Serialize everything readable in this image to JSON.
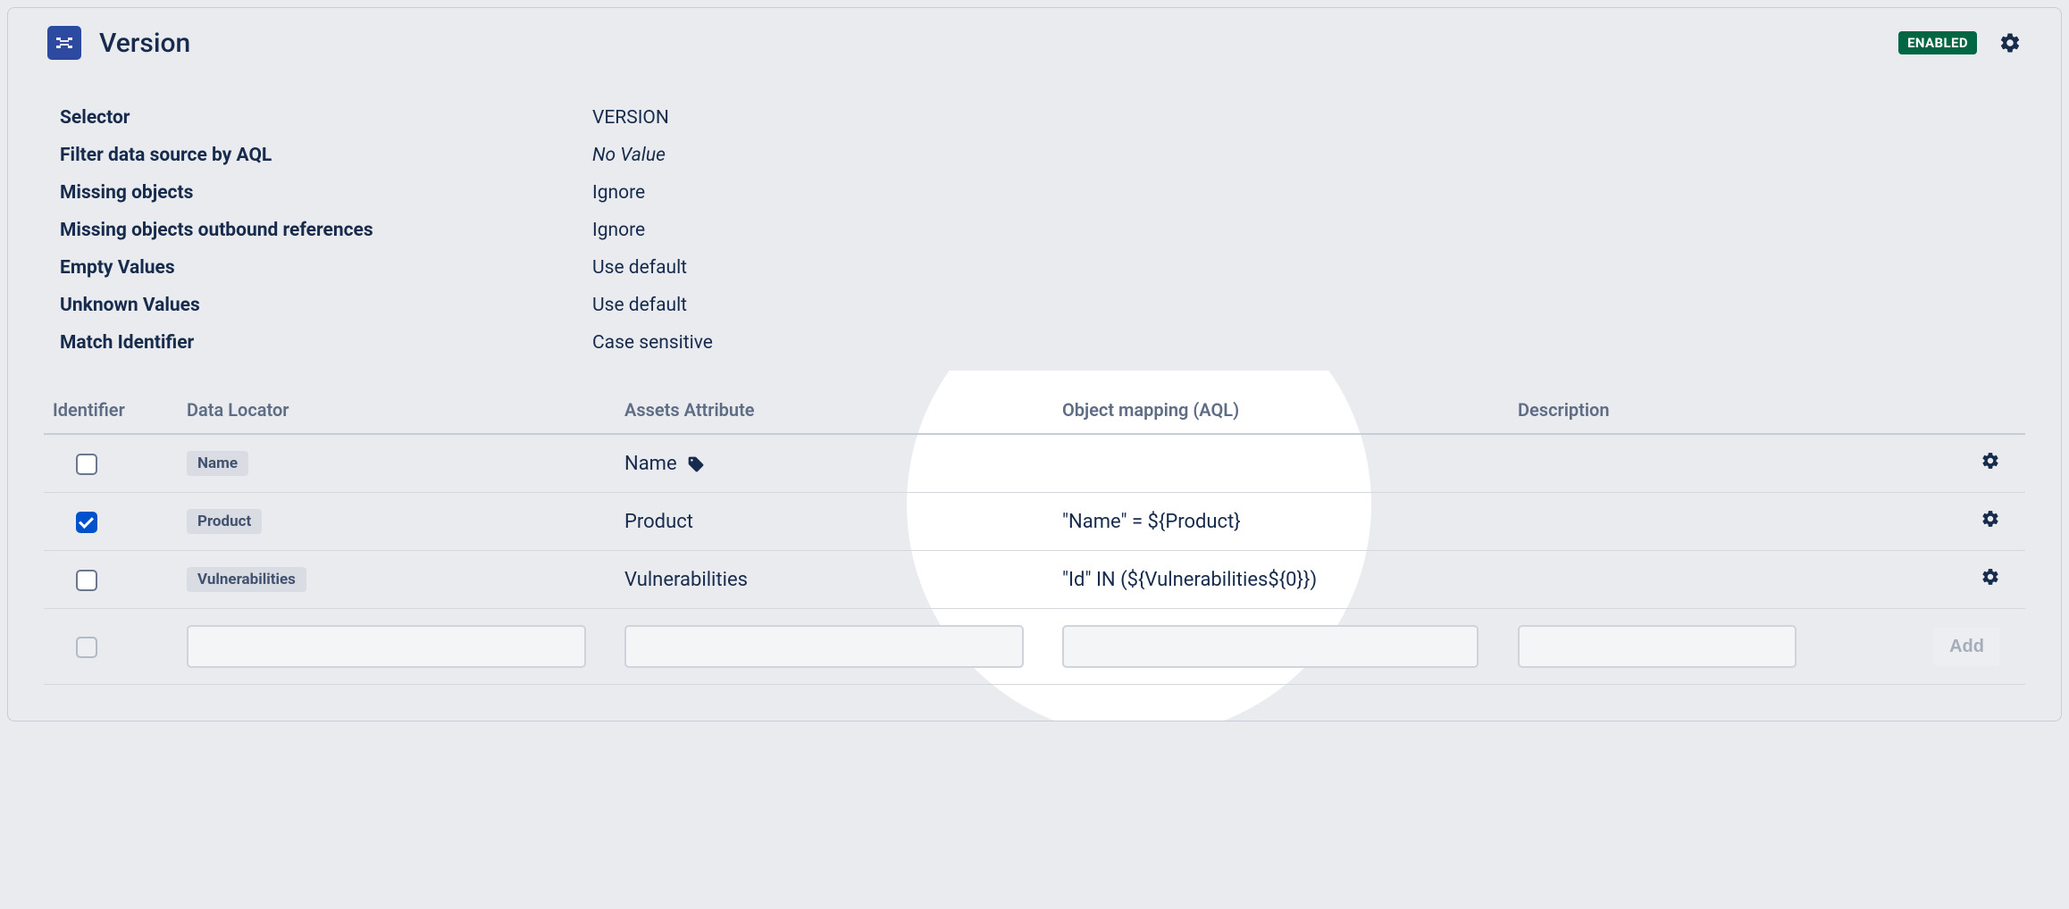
{
  "header": {
    "title": "Version",
    "status_badge": "ENABLED"
  },
  "properties": {
    "rows": [
      {
        "label": "Selector",
        "value": "VERSION",
        "italic": false
      },
      {
        "label": "Filter data source by AQL",
        "value": "No Value",
        "italic": true
      },
      {
        "label": "Missing objects",
        "value": "Ignore",
        "italic": false
      },
      {
        "label": "Missing objects outbound references",
        "value": "Ignore",
        "italic": false
      },
      {
        "label": "Empty Values",
        "value": "Use default",
        "italic": false
      },
      {
        "label": "Unknown Values",
        "value": "Use default",
        "italic": false
      },
      {
        "label": "Match Identifier",
        "value": "Case sensitive",
        "italic": false
      }
    ]
  },
  "table": {
    "headers": {
      "identifier": "Identifier",
      "data_locator": "Data Locator",
      "assets_attribute": "Assets Attribute",
      "object_mapping": "Object mapping (AQL)",
      "description": "Description"
    },
    "rows": [
      {
        "checked": false,
        "locator": "Name",
        "attribute": "Name",
        "has_tag_icon": true,
        "mapping": "",
        "description": ""
      },
      {
        "checked": true,
        "locator": "Product",
        "attribute": "Product",
        "has_tag_icon": false,
        "mapping": "\"Name\" = ${Product}",
        "description": ""
      },
      {
        "checked": false,
        "locator": "Vulnerabilities",
        "attribute": "Vulnerabilities",
        "has_tag_icon": false,
        "mapping": "\"Id\" IN (${Vulnerabilities${0}})",
        "description": ""
      }
    ],
    "add_button": "Add"
  }
}
